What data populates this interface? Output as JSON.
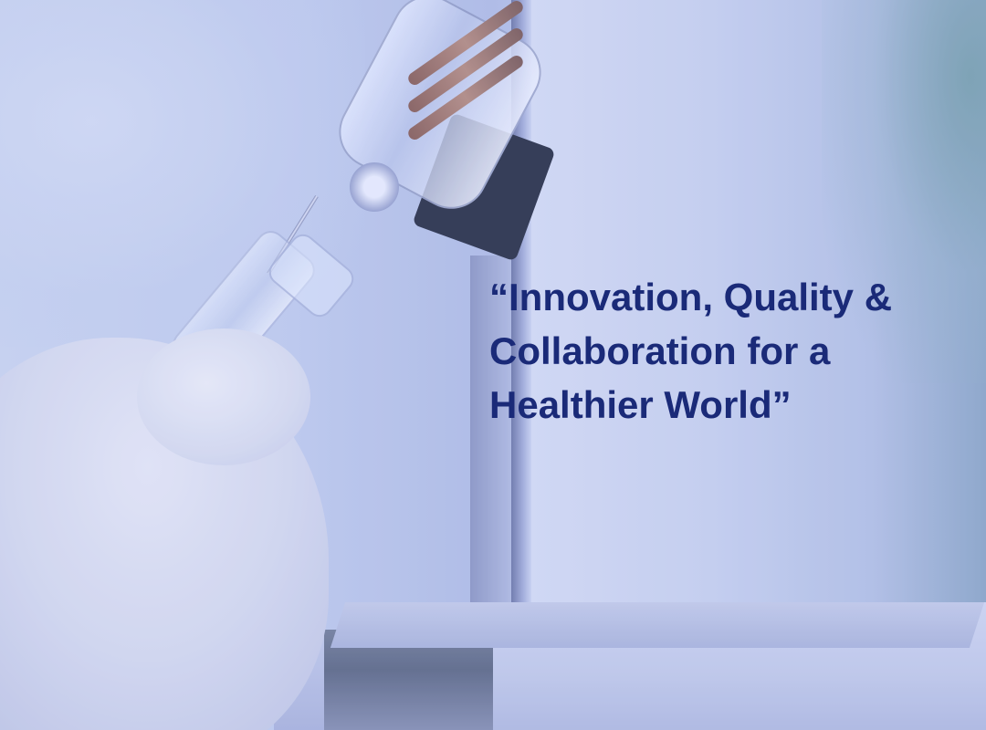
{
  "slide": {
    "quote_lines": [
      "“Innovation, Quality &",
      "Collaboration for a",
      "Healthier World”"
    ],
    "text_color": "#1a2a78"
  }
}
